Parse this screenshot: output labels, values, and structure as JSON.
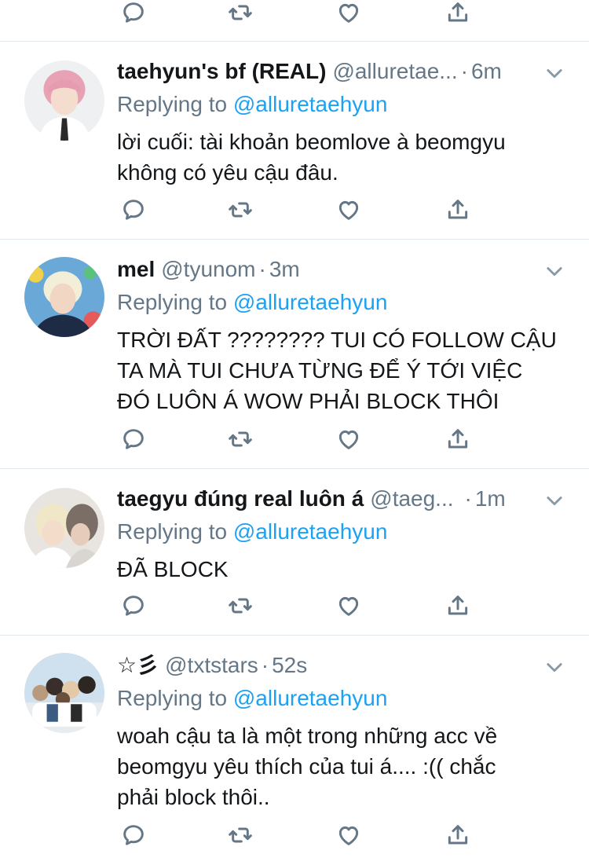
{
  "icons": {
    "reply": "reply-icon",
    "retweet": "retweet-icon",
    "like": "heart-icon",
    "share": "share-icon",
    "more": "chevron-down-icon"
  },
  "colors": {
    "link": "#1da1f2",
    "muted": "#657786",
    "divider": "#e1e8ed",
    "text": "#14171a"
  },
  "tweets": [
    {
      "name": "taehyun's bf (REAL)",
      "handle": "@alluretae...",
      "dot": "·",
      "time": "6m",
      "replying_prefix": "Replying to",
      "replying_to": "@alluretaehyun",
      "text": "lời cuối: tài khoản beomlove à beomgyu\nkhông có yêu cậu đâu."
    },
    {
      "name": "mel",
      "handle": "@tyunom",
      "dot": "·",
      "time": "3m",
      "replying_prefix": "Replying to",
      "replying_to": "@alluretaehyun",
      "text": "TRỜI ĐẤT ???????? TUI CÓ FOLLOW CẬU\nTA MÀ TUI CHƯA TỪNG ĐỂ Ý TỚI VIỆC\nĐÓ LUÔN Á WOW PHẢI BLOCK THÔI"
    },
    {
      "name": "taegyu đúng real luôn á",
      "handle": "@taeg...",
      "dot": "·",
      "time": "1m",
      "replying_prefix": "Replying to",
      "replying_to": "@alluretaehyun",
      "text": "ĐÃ BLOCK"
    },
    {
      "name": "☆彡",
      "handle": "@txtstars",
      "dot": "·",
      "time": "52s",
      "replying_prefix": "Replying to",
      "replying_to": "@alluretaehyun",
      "text": "woah cậu ta là một trong những acc về\nbeomgyu yêu thích của tui á.... :(( chắc\nphải block thôi.."
    }
  ]
}
